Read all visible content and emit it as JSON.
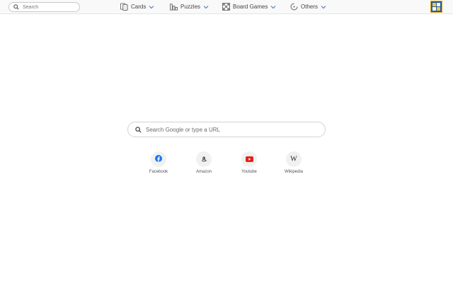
{
  "topbar": {
    "search": {
      "placeholder": "Search",
      "value": ""
    },
    "nav": [
      {
        "label": "Cards",
        "icon": "cards-icon"
      },
      {
        "label": "Puzzles",
        "icon": "puzzle-bars-icon"
      },
      {
        "label": "Board Games",
        "icon": "board-grid-icon"
      },
      {
        "label": "Others",
        "icon": "spinner-icon"
      }
    ],
    "logo": {
      "icon": "app-logo-icon",
      "colors": {
        "frame": "#d9a626",
        "fill": "#2a5d8f",
        "tile": "#f2c744"
      }
    }
  },
  "main": {
    "search": {
      "placeholder": "Search Google or type a URL",
      "value": ""
    },
    "shortcuts": [
      {
        "label": "Facebook",
        "icon": "facebook-icon",
        "color": "#1877f2"
      },
      {
        "label": "Amazon",
        "icon": "amazon-icon",
        "color": "#111111"
      },
      {
        "label": "Youtube",
        "icon": "youtube-icon",
        "color": "#e62117"
      },
      {
        "label": "Wikipedia",
        "icon": "wikipedia-icon",
        "color": "#222222"
      }
    ]
  }
}
